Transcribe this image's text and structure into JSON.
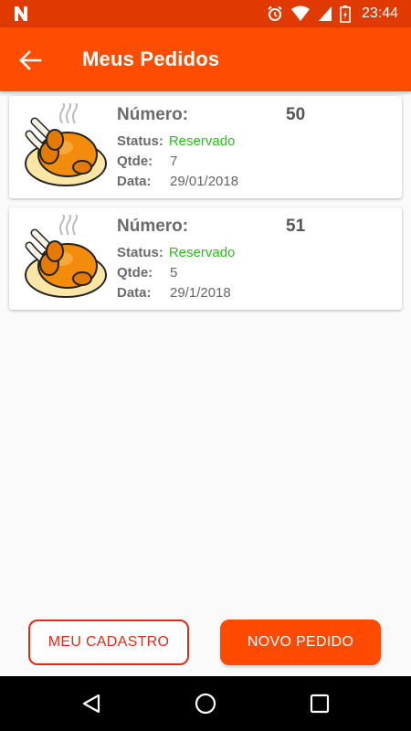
{
  "status_bar": {
    "time": "23:44",
    "icons": [
      "n-logo-icon",
      "alarm-icon",
      "wifi-icon",
      "signal-icon",
      "battery-icon"
    ]
  },
  "app_bar": {
    "title": "Meus Pedidos",
    "back_icon": "arrow-back-icon",
    "color": "#ff4d00"
  },
  "orders": [
    {
      "numero_label": "Número:",
      "numero": "50",
      "status_label": "Status:",
      "status": "Reservado",
      "qtde_label": "Qtde:",
      "qtde": "7",
      "data_label": "Data:",
      "data": "29/01/2018",
      "image": "roast-chicken-icon"
    },
    {
      "numero_label": "Número:",
      "numero": "51",
      "status_label": "Status:",
      "status": "Reservado",
      "qtde_label": "Qtde:",
      "qtde": "5",
      "data_label": "Data:",
      "data": "29/1/2018",
      "image": "roast-chicken-icon"
    }
  ],
  "buttons": {
    "meu_cadastro": "MEU CADASTRO",
    "novo_pedido": "NOVO PEDIDO"
  },
  "colors": {
    "accent": "#ff4a00",
    "status_green": "#2dbb1f",
    "outline_red": "#e02a1c"
  },
  "nav_bar": [
    "back-triangle-icon",
    "home-circle-icon",
    "recents-square-icon"
  ]
}
